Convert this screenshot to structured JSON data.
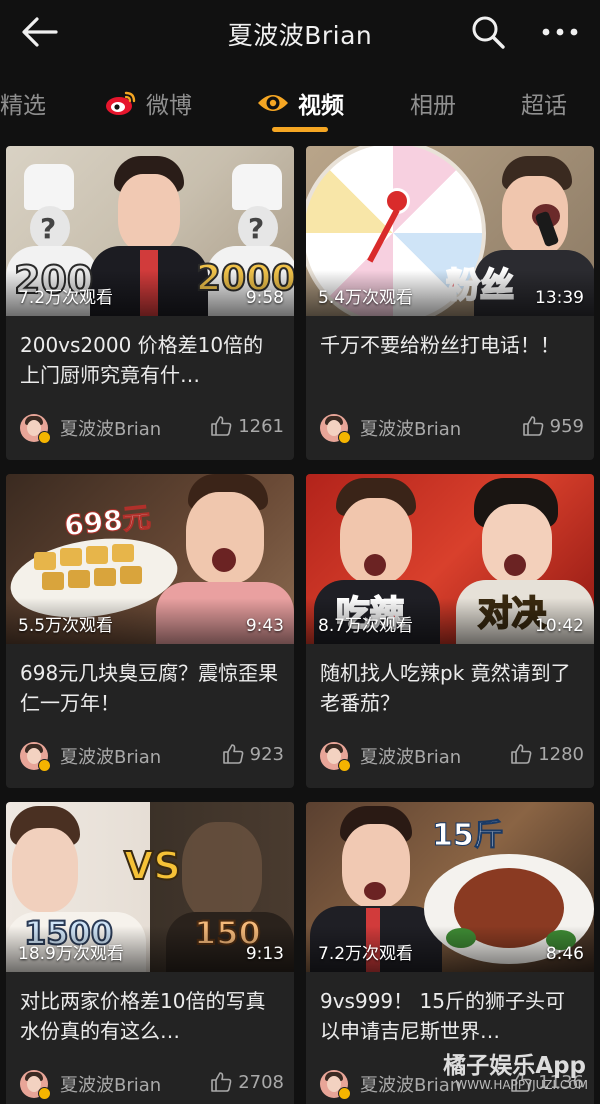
{
  "header": {
    "title": "夏波波Brian",
    "icons": {
      "back": "arrow-left-icon",
      "search": "search-icon",
      "more": "more-dots-icon"
    }
  },
  "tabs": [
    {
      "label": "精选",
      "active": false
    },
    {
      "label": "微博",
      "active": false,
      "icon": "weibo-icon"
    },
    {
      "label": "视频",
      "active": true,
      "icon": "video-eye-icon"
    },
    {
      "label": "相册",
      "active": false
    },
    {
      "label": "超话",
      "active": false
    }
  ],
  "colors": {
    "accent": "#f5a623",
    "background": "#111111",
    "card": "#232323",
    "badge": "#f5b400"
  },
  "videos": [
    {
      "views": "7.2万次观看",
      "duration": "9:58",
      "title": "200vs2000 价格差10倍的上门厨师究竟有什…",
      "author": "夏波波Brian",
      "likes": "1261",
      "overlay": [
        "200",
        "2000"
      ]
    },
    {
      "views": "5.4万次观看",
      "duration": "13:39",
      "title": "千万不要给粉丝打电话！！",
      "author": "夏波波Brian",
      "likes": "959",
      "overlay": [
        "粉丝"
      ]
    },
    {
      "views": "5.5万次观看",
      "duration": "9:43",
      "title": "698元几块臭豆腐？震惊歪果仁一万年！",
      "author": "夏波波Brian",
      "likes": "923",
      "overlay": [
        "698元"
      ]
    },
    {
      "views": "8.7万次观看",
      "duration": "10:42",
      "title": "随机找人吃辣pk 竟然请到了老番茄？",
      "author": "夏波波Brian",
      "likes": "1280",
      "overlay": [
        "吃辣",
        "对决"
      ]
    },
    {
      "views": "18.9万次观看",
      "duration": "9:13",
      "title": "对比两家价格差10倍的写真 水份真的有这么…",
      "author": "夏波波Brian",
      "likes": "2708",
      "overlay": [
        "1500",
        "VS",
        "150"
      ]
    },
    {
      "views": "7.2万次观看",
      "duration": "8:46",
      "title": "9vs999！ 15斤的狮子头可以申请吉尼斯世界…",
      "author": "夏波波Brian",
      "likes": "1136",
      "overlay": [
        "15斤"
      ]
    }
  ],
  "watermark": {
    "main": "橘子娱乐App",
    "sub": "WWW.HAPPYJUZI.COM"
  }
}
